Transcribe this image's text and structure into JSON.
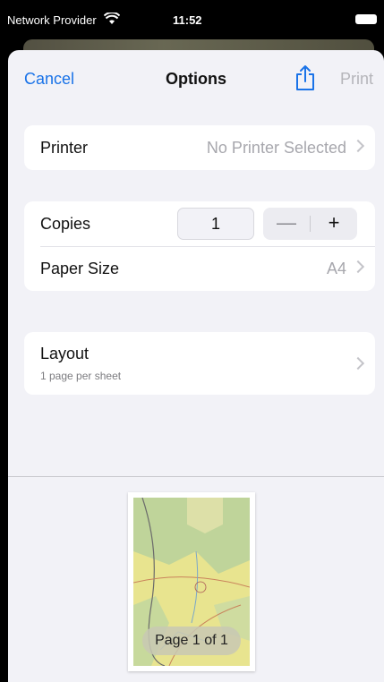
{
  "status_bar": {
    "carrier": "Network Provider",
    "time": "11:52"
  },
  "nav": {
    "cancel": "Cancel",
    "title": "Options",
    "print": "Print",
    "share_icon": "share-icon"
  },
  "printer_row": {
    "label": "Printer",
    "value": "No Printer Selected"
  },
  "copies_row": {
    "label": "Copies",
    "value": "1",
    "minus": "—",
    "plus": "+"
  },
  "paper_row": {
    "label": "Paper Size",
    "value": "A4"
  },
  "layout_row": {
    "label": "Layout",
    "sublabel": "1 page per sheet"
  },
  "preview": {
    "page_label": "Page 1 of 1"
  },
  "colors": {
    "accent": "#1a73e8",
    "disabled": "#b5b5ba",
    "sheet_bg": "#f2f2f7"
  }
}
